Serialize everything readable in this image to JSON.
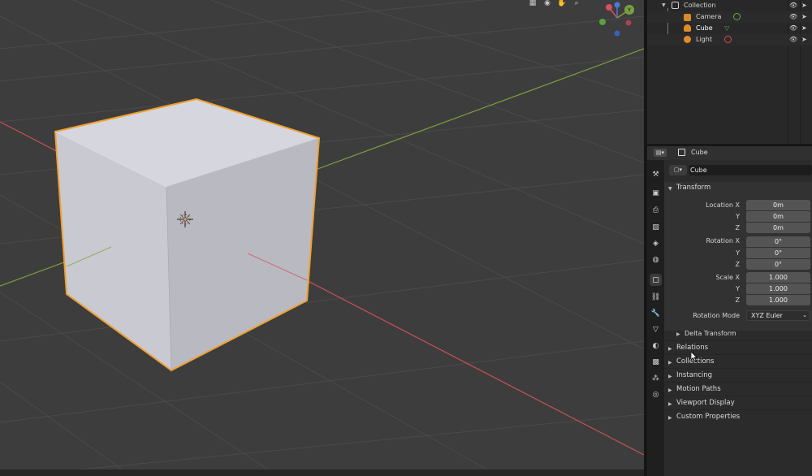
{
  "viewport": {
    "header_icons": [
      "grid-icon",
      "camera-view-icon",
      "hand-icon",
      "zoom-icon"
    ],
    "gizmo": {
      "y_label": "Y",
      "x_label": "X",
      "z_label": "Z"
    },
    "colors": {
      "grid_bg": "#3d3d3d",
      "x_axis": "#c8505a",
      "y_axis": "#7f9b3d",
      "selection_outline": "#f0a030",
      "cube_light": "#d6d6df",
      "cube_mid": "#bfbfc7",
      "cube_dark": "#aeaeb6"
    }
  },
  "outliner": {
    "items": [
      {
        "label": "Collection",
        "icon": "collection-icon",
        "color": "#d8d8d8"
      },
      {
        "label": "Camera",
        "icon": "camera-icon",
        "color": "#d88a2a",
        "extra_icon": "camera-data-icon",
        "extra_color": "#6aa84f"
      },
      {
        "label": "Cube",
        "icon": "mesh-icon",
        "color": "#e08a2a",
        "extra_icon": "mesh-data-icon",
        "extra_color": "#6aa84f"
      },
      {
        "label": "Light",
        "icon": "light-icon",
        "color": "#e08a2a",
        "extra_icon": "light-data-icon",
        "extra_color": "#d84a4a"
      }
    ]
  },
  "properties": {
    "header_object": "Cube",
    "object_name": "Cube",
    "transform_title": "Transform",
    "location": {
      "label": "Location X",
      "x": "0m",
      "y": "0m",
      "z": "0m",
      "y_label": "Y",
      "z_label": "Z"
    },
    "rotation": {
      "label": "Rotation X",
      "x": "0°",
      "y": "0°",
      "z": "0°",
      "y_label": "Y",
      "z_label": "Z"
    },
    "scale": {
      "label": "Scale X",
      "x": "1.000",
      "y": "1.000",
      "z": "1.000",
      "y_label": "Y",
      "z_label": "Z"
    },
    "rotation_mode_label": "Rotation Mode",
    "rotation_mode_value": "XYZ Euler",
    "delta_transform": "Delta Transform",
    "panels": [
      "Relations",
      "Collections",
      "Instancing",
      "Motion Paths",
      "Viewport Display",
      "Custom Properties"
    ],
    "tabs": [
      "tool-icon",
      "render-icon",
      "output-icon",
      "view-layer-icon",
      "scene-icon",
      "world-icon",
      "object-icon",
      "modifier-icon",
      "particles-icon",
      "physics-icon",
      "constraints-icon",
      "data-icon",
      "material-icon",
      "texture-icon"
    ]
  }
}
